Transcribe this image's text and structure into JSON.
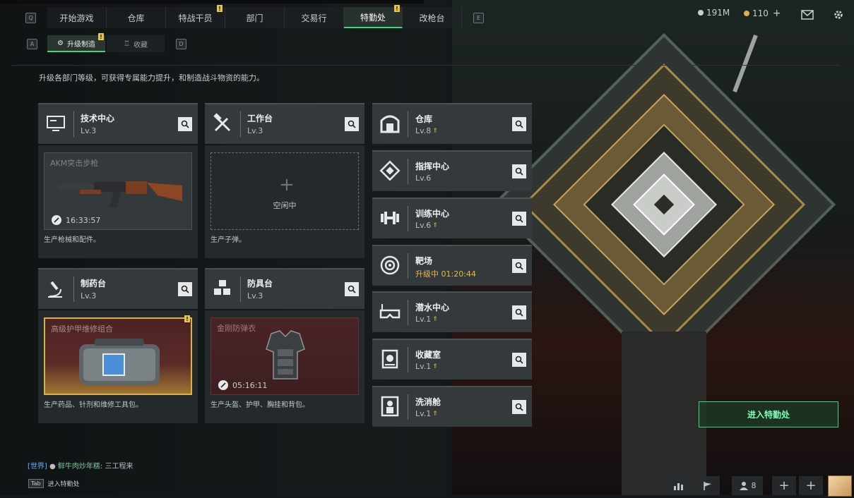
{
  "top_nav": {
    "left_key": "Q",
    "right_key": "E",
    "tabs": [
      {
        "label": "开始游戏",
        "badge": ""
      },
      {
        "label": "仓库",
        "badge": ""
      },
      {
        "label": "特战干员",
        "badge": "!"
      },
      {
        "label": "部门",
        "badge": ""
      },
      {
        "label": "交易行",
        "badge": ""
      },
      {
        "label": "特勤处",
        "badge": "!"
      },
      {
        "label": "改枪台",
        "badge": ""
      }
    ],
    "active_tab": "特勤处"
  },
  "currency": {
    "silver": "191M",
    "gold": "110",
    "gold_add": "+"
  },
  "sub_nav": {
    "left_key": "A",
    "right_key": "D",
    "tabs": [
      {
        "label": "升级制造",
        "badge": "!"
      },
      {
        "label": "收藏",
        "badge": ""
      }
    ]
  },
  "description": "升级各部门等级，可获得专属能力提升，和制造战斗物资的能力。",
  "facilities": [
    {
      "name": "技术中心",
      "level": "Lv.3",
      "slot_name": "AKM突击步枪",
      "timer": "16:33:57",
      "footer": "生产枪械和配件。"
    },
    {
      "name": "工作台",
      "level": "Lv.3",
      "slot_label": "空闲中",
      "footer": "生产子弹。"
    },
    {
      "name": "制药台",
      "level": "Lv.3",
      "slot_name": "高级护甲维修组合",
      "badge": "!",
      "footer": "生产药品、针剂和维修工具包。"
    },
    {
      "name": "防具台",
      "level": "Lv.3",
      "slot_name": "金刚防弹衣",
      "timer": "05:16:11",
      "footer": "生产头盔、护甲、胸挂和背包。"
    }
  ],
  "small_facilities": [
    {
      "name": "仓库",
      "level": "Lv.8",
      "upgradable": true,
      "icon": "warehouse-icon"
    },
    {
      "name": "指挥中心",
      "level": "Lv.6",
      "upgradable": false,
      "icon": "command-icon"
    },
    {
      "name": "训练中心",
      "level": "Lv.6",
      "upgradable": true,
      "icon": "dumbbell-icon"
    },
    {
      "name": "靶场",
      "level": "升级中 01:20:44",
      "upgradable": false,
      "icon": "target-icon"
    },
    {
      "name": "潜水中心",
      "level": "Lv.1",
      "upgradable": true,
      "icon": "diving-mask-icon"
    },
    {
      "name": "收藏室",
      "level": "Lv.1",
      "upgradable": true,
      "icon": "collection-icon"
    },
    {
      "name": "洗消舱",
      "level": "Lv.1",
      "upgradable": true,
      "icon": "decontamination-icon"
    }
  ],
  "enter_button": "进入特勤处",
  "chat": {
    "channel": "[世界]",
    "sender": "鲜牛肉炒年糕",
    "message": "三工程来"
  },
  "tab_hint": {
    "key": "Tab",
    "label": "进入特勤处"
  },
  "bottom_bar": {
    "friends_count": "8"
  },
  "colors": {
    "accent": "#3bd882",
    "badge": "#e8c547",
    "upgrade": "#e5bb48"
  }
}
